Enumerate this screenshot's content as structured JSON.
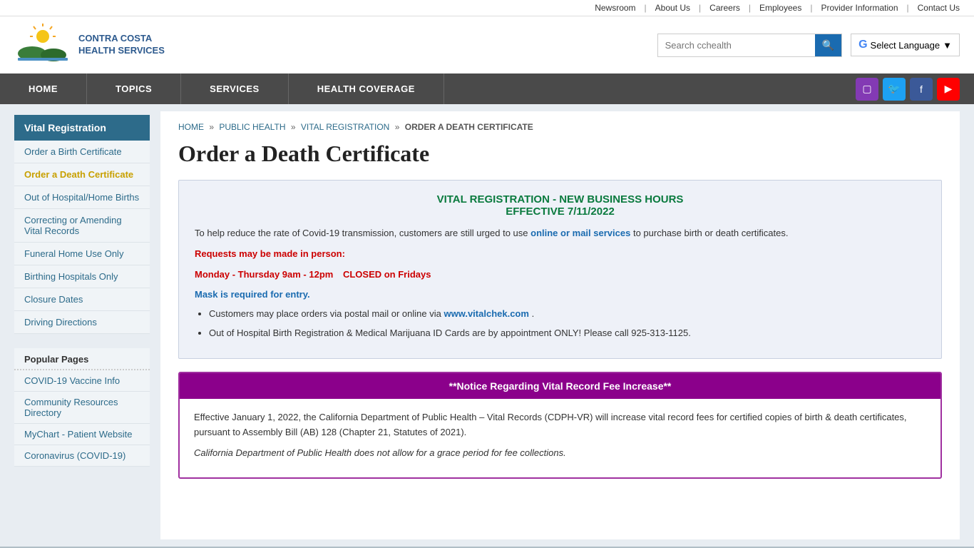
{
  "utility": {
    "links": [
      "Newsroom",
      "About Us",
      "Careers",
      "Employees",
      "Provider Information",
      "Contact Us"
    ]
  },
  "header": {
    "logo_line1": "CONTRA COSTA",
    "logo_line2": "HEALTH SERVICES",
    "search_placeholder": "Search cchealth",
    "search_btn_label": "🔍",
    "translate_label": "Select Language"
  },
  "nav": {
    "items": [
      "HOME",
      "TOPICS",
      "SERVICES",
      "HEALTH COVERAGE"
    ]
  },
  "sidebar": {
    "title": "Vital Registration",
    "items": [
      {
        "label": "Order a Birth Certificate",
        "active": false
      },
      {
        "label": "Order a Death Certificate",
        "active": true
      },
      {
        "label": "Out of Hospital/Home Births",
        "active": false
      },
      {
        "label": "Correcting or Amending Vital Records",
        "active": false
      },
      {
        "label": "Funeral Home Use Only",
        "active": false
      },
      {
        "label": "Birthing Hospitals Only",
        "active": false
      },
      {
        "label": "Closure Dates",
        "active": false
      },
      {
        "label": "Driving Directions",
        "active": false
      }
    ],
    "popular_title": "Popular Pages",
    "popular_items": [
      "COVID-19 Vaccine Info",
      "Community Resources Directory",
      "MyChart - Patient Website",
      "Coronavirus (COVID-19)"
    ]
  },
  "breadcrumb": {
    "items": [
      "HOME",
      "PUBLIC HEALTH",
      "VITAL REGISTRATION"
    ],
    "current": "ORDER A DEATH CERTIFICATE"
  },
  "page": {
    "title": "Order a Death Certificate",
    "info_box": {
      "title_line1": "VITAL REGISTRATION - NEW BUSINESS HOURS",
      "title_line2": "EFFECTIVE 7/11/2022",
      "para1": "To help reduce the rate of Covid-19 transmission, customers are still urged to use",
      "link_text": "online or mail services",
      "para1_end": "to purchase birth or death certificates.",
      "in_person_label": "Requests may be made in person:",
      "hours": "Monday - Thursday 9am - 12pm",
      "closed": "CLOSED on Fridays",
      "mask": "Mask is required for entry.",
      "bullet1": "Customers may place orders via postal mail or online via",
      "bullet1_link": "www.vitalchek.com",
      "bullet1_end": ".",
      "bullet2": "Out of Hospital Birth Registration & Medical Marijuana ID Cards are by appointment ONLY! Please call 925-313-1125."
    },
    "notice": {
      "header": "**Notice Regarding Vital Record Fee Increase**",
      "para1": "Effective January 1, 2022, the California Department of Public Health – Vital Records (CDPH-VR) will increase vital record fees for certified copies of birth & death certificates, pursuant to Assembly Bill (AB) 128 (Chapter 21, Statutes of 2021).",
      "para2": "California Department of Public Health does not allow for a grace period for fee collections."
    }
  }
}
